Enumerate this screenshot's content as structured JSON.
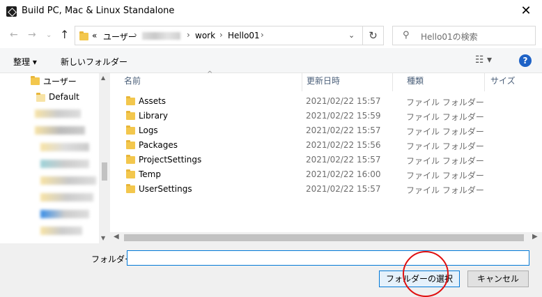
{
  "window": {
    "title": "Build PC, Mac & Linux Standalone",
    "close_glyph": "✕"
  },
  "address": {
    "overflow": "«",
    "crumbs": [
      "ユーザー",
      "work",
      "Hello01"
    ],
    "sep": "›"
  },
  "search": {
    "placeholder": "Hello01の検索"
  },
  "toolbar": {
    "organize": "整理 ▾",
    "new_folder": "新しいフォルダー"
  },
  "tree": [
    {
      "label": "ユーザー"
    },
    {
      "label": "Default"
    }
  ],
  "columns": {
    "name": "名前",
    "date": "更新日時",
    "type": "種類",
    "size": "サイズ"
  },
  "files": [
    {
      "name": "Assets",
      "date": "2021/02/22 15:57",
      "type": "ファイル フォルダー"
    },
    {
      "name": "Library",
      "date": "2021/02/22 15:59",
      "type": "ファイル フォルダー"
    },
    {
      "name": "Logs",
      "date": "2021/02/22 15:57",
      "type": "ファイル フォルダー"
    },
    {
      "name": "Packages",
      "date": "2021/02/22 15:56",
      "type": "ファイル フォルダー"
    },
    {
      "name": "ProjectSettings",
      "date": "2021/02/22 15:57",
      "type": "ファイル フォルダー"
    },
    {
      "name": "Temp",
      "date": "2021/02/22 16:00",
      "type": "ファイル フォルダー"
    },
    {
      "name": "UserSettings",
      "date": "2021/02/22 15:57",
      "type": "ファイル フォルダー"
    }
  ],
  "footer": {
    "folder_label": "フォルダー:",
    "folder_value": "",
    "select_button": "フォルダーの選択",
    "cancel_button": "キャンセル"
  },
  "colors": {
    "accent": "#0078d7",
    "annotation": "#e01010",
    "folder": "#f3c74d"
  }
}
